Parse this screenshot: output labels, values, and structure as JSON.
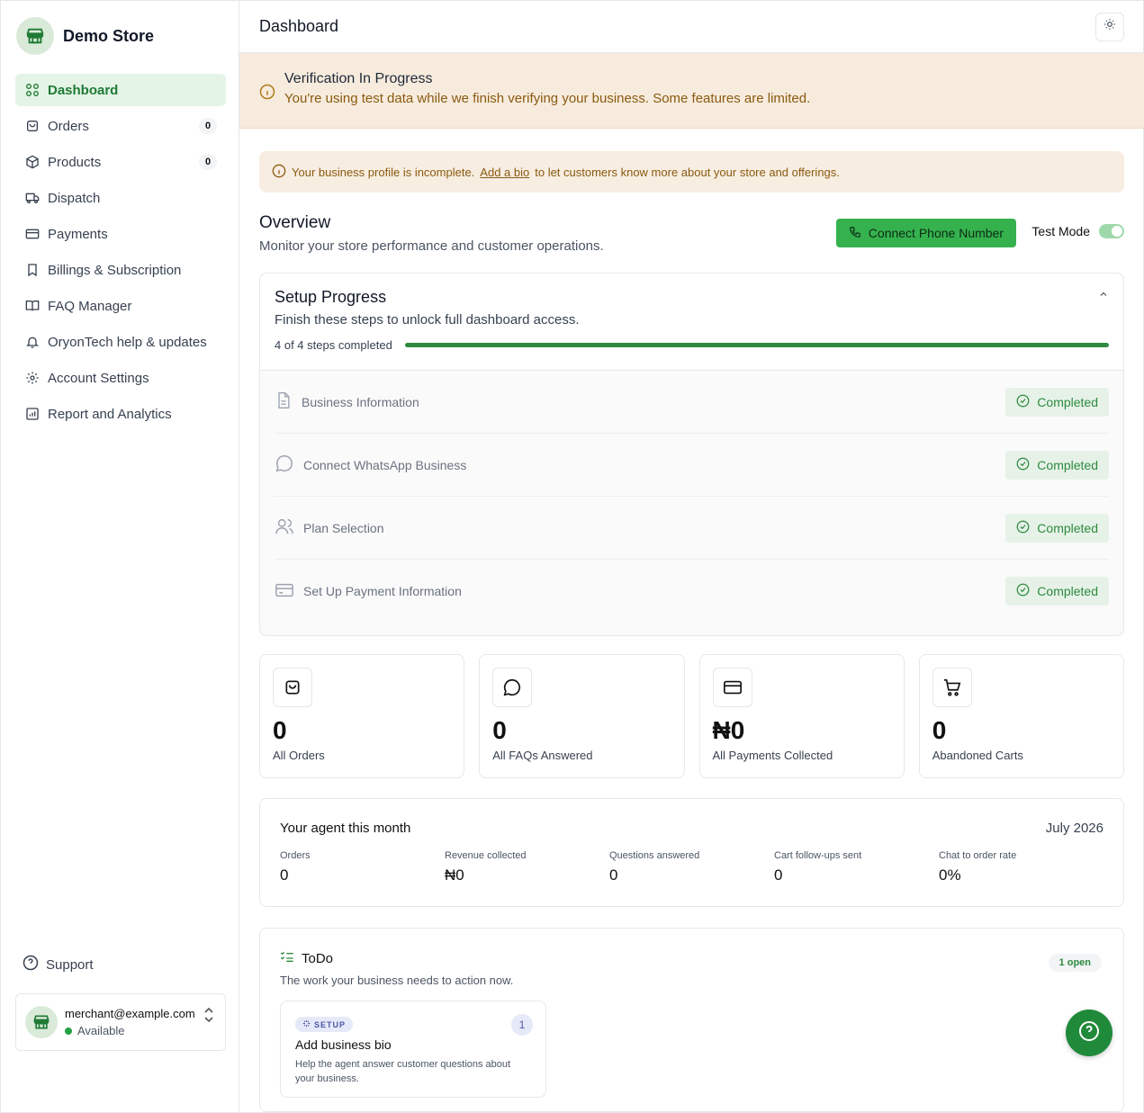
{
  "brand": {
    "name": "Demo Store"
  },
  "sidebar": {
    "items": [
      {
        "label": "Dashboard",
        "icon": "grid-icon",
        "active": true
      },
      {
        "label": "Orders",
        "icon": "orders-icon",
        "badge": "0"
      },
      {
        "label": "Products",
        "icon": "box-icon",
        "badge": "0"
      },
      {
        "label": "Dispatch",
        "icon": "truck-icon"
      },
      {
        "label": "Payments",
        "icon": "card-icon"
      },
      {
        "label": "Billings & Subscription",
        "icon": "bookmark-icon"
      },
      {
        "label": "FAQ Manager",
        "icon": "book-icon"
      },
      {
        "label": "OryonTech help & updates",
        "icon": "bell-icon"
      },
      {
        "label": "Account Settings",
        "icon": "gear-icon"
      },
      {
        "label": "Report and Analytics",
        "icon": "chart-icon"
      }
    ],
    "support_label": "Support",
    "user": {
      "email": "merchant@example.com",
      "status": "Available"
    }
  },
  "topbar": {
    "title": "Dashboard"
  },
  "verification": {
    "title": "Verification In Progress",
    "text": "You're using test data while we finish verifying your business. Some features are limited."
  },
  "profile_note": {
    "before": "Your business profile is incomplete.",
    "link": "Add a bio",
    "after": "to let customers know more about your store and offerings."
  },
  "overview": {
    "title": "Overview",
    "subtitle": "Monitor your store performance and customer operations.",
    "connect_label": "Connect Phone Number",
    "test_mode_label": "Test Mode"
  },
  "setup": {
    "title": "Setup Progress",
    "subtitle": "Finish these steps to unlock full dashboard access.",
    "progress_text": "4 of 4 steps completed",
    "progress_fraction": 1.0,
    "steps": [
      {
        "label": "Business Information",
        "status": "Completed"
      },
      {
        "label": "Connect WhatsApp Business",
        "status": "Completed"
      },
      {
        "label": "Plan Selection",
        "status": "Completed"
      },
      {
        "label": "Set Up Payment Information",
        "status": "Completed"
      }
    ]
  },
  "stats": [
    {
      "value": "0",
      "label": "All Orders"
    },
    {
      "value": "0",
      "label": "All FAQs Answered"
    },
    {
      "value": "₦0",
      "label": "All Payments Collected"
    },
    {
      "value": "0",
      "label": "Abandoned Carts"
    }
  ],
  "agent": {
    "title": "Your agent this month",
    "month": "July 2026",
    "metrics": [
      {
        "label": "Orders",
        "value": "0"
      },
      {
        "label": "Revenue collected",
        "value": "₦0"
      },
      {
        "label": "Questions answered",
        "value": "0"
      },
      {
        "label": "Cart follow-ups sent",
        "value": "0"
      },
      {
        "label": "Chat to order rate",
        "value": "0%"
      }
    ]
  },
  "todo": {
    "title": "ToDo",
    "subtitle": "The work your business needs to action now.",
    "open_label": "1 open",
    "card": {
      "tag": "SETUP",
      "count": "1",
      "title": "Add business bio",
      "description": "Help the agent answer customer questions about your business."
    }
  },
  "colors": {
    "accent": "#35b24e",
    "brand_green": "#1f8a3a",
    "warning_bg": "#f7ebdd"
  }
}
